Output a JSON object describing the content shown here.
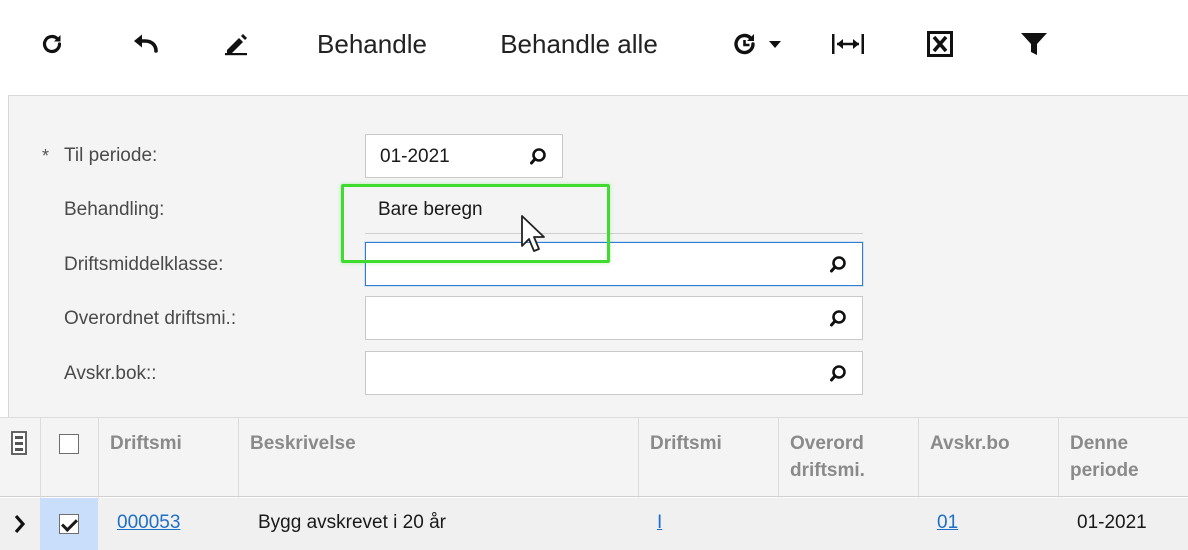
{
  "toolbar": {
    "refresh_icon": "refresh-icon",
    "undo_icon": "undo-icon",
    "edit_icon": "pencil-icon",
    "process_label": "Behandle",
    "process_all_label": "Behandle alle",
    "schedule_icon": "schedule-refresh-icon",
    "fit_icon": "fit-columns-icon",
    "excel_icon": "excel-icon",
    "filter_icon": "filter-icon"
  },
  "form": {
    "required_mark": "*",
    "period_label": "Til periode:",
    "period_value": "01-2021",
    "treatment_label": "Behandling:",
    "treatment_value": "Bare beregn",
    "asset_class_label": "Driftsmiddelklasse:",
    "asset_class_value": "",
    "parent_asset_label": "Overordnet driftsmi.:",
    "parent_asset_value": "",
    "book_label": "Avskr.bok::",
    "book_value": ""
  },
  "grid": {
    "columns": [
      "Driftsmi",
      "Beskrivelse",
      "Driftsmi",
      "Overord driftsmi.",
      "Avskr.bo",
      "Denne periode"
    ],
    "rows": [
      {
        "selected": true,
        "asset_id": "000053",
        "description": "Bygg avskrevet i 20 år",
        "asset_type": "I",
        "parent": "",
        "book": "01",
        "period": "01-2021"
      }
    ]
  },
  "colors": {
    "accent": "#1d6fc7",
    "focus_border": "#2f7cd3",
    "highlight": "#3fdc2f",
    "selected_cell": "#c9defa",
    "panel_bg": "#f4f4f5"
  }
}
